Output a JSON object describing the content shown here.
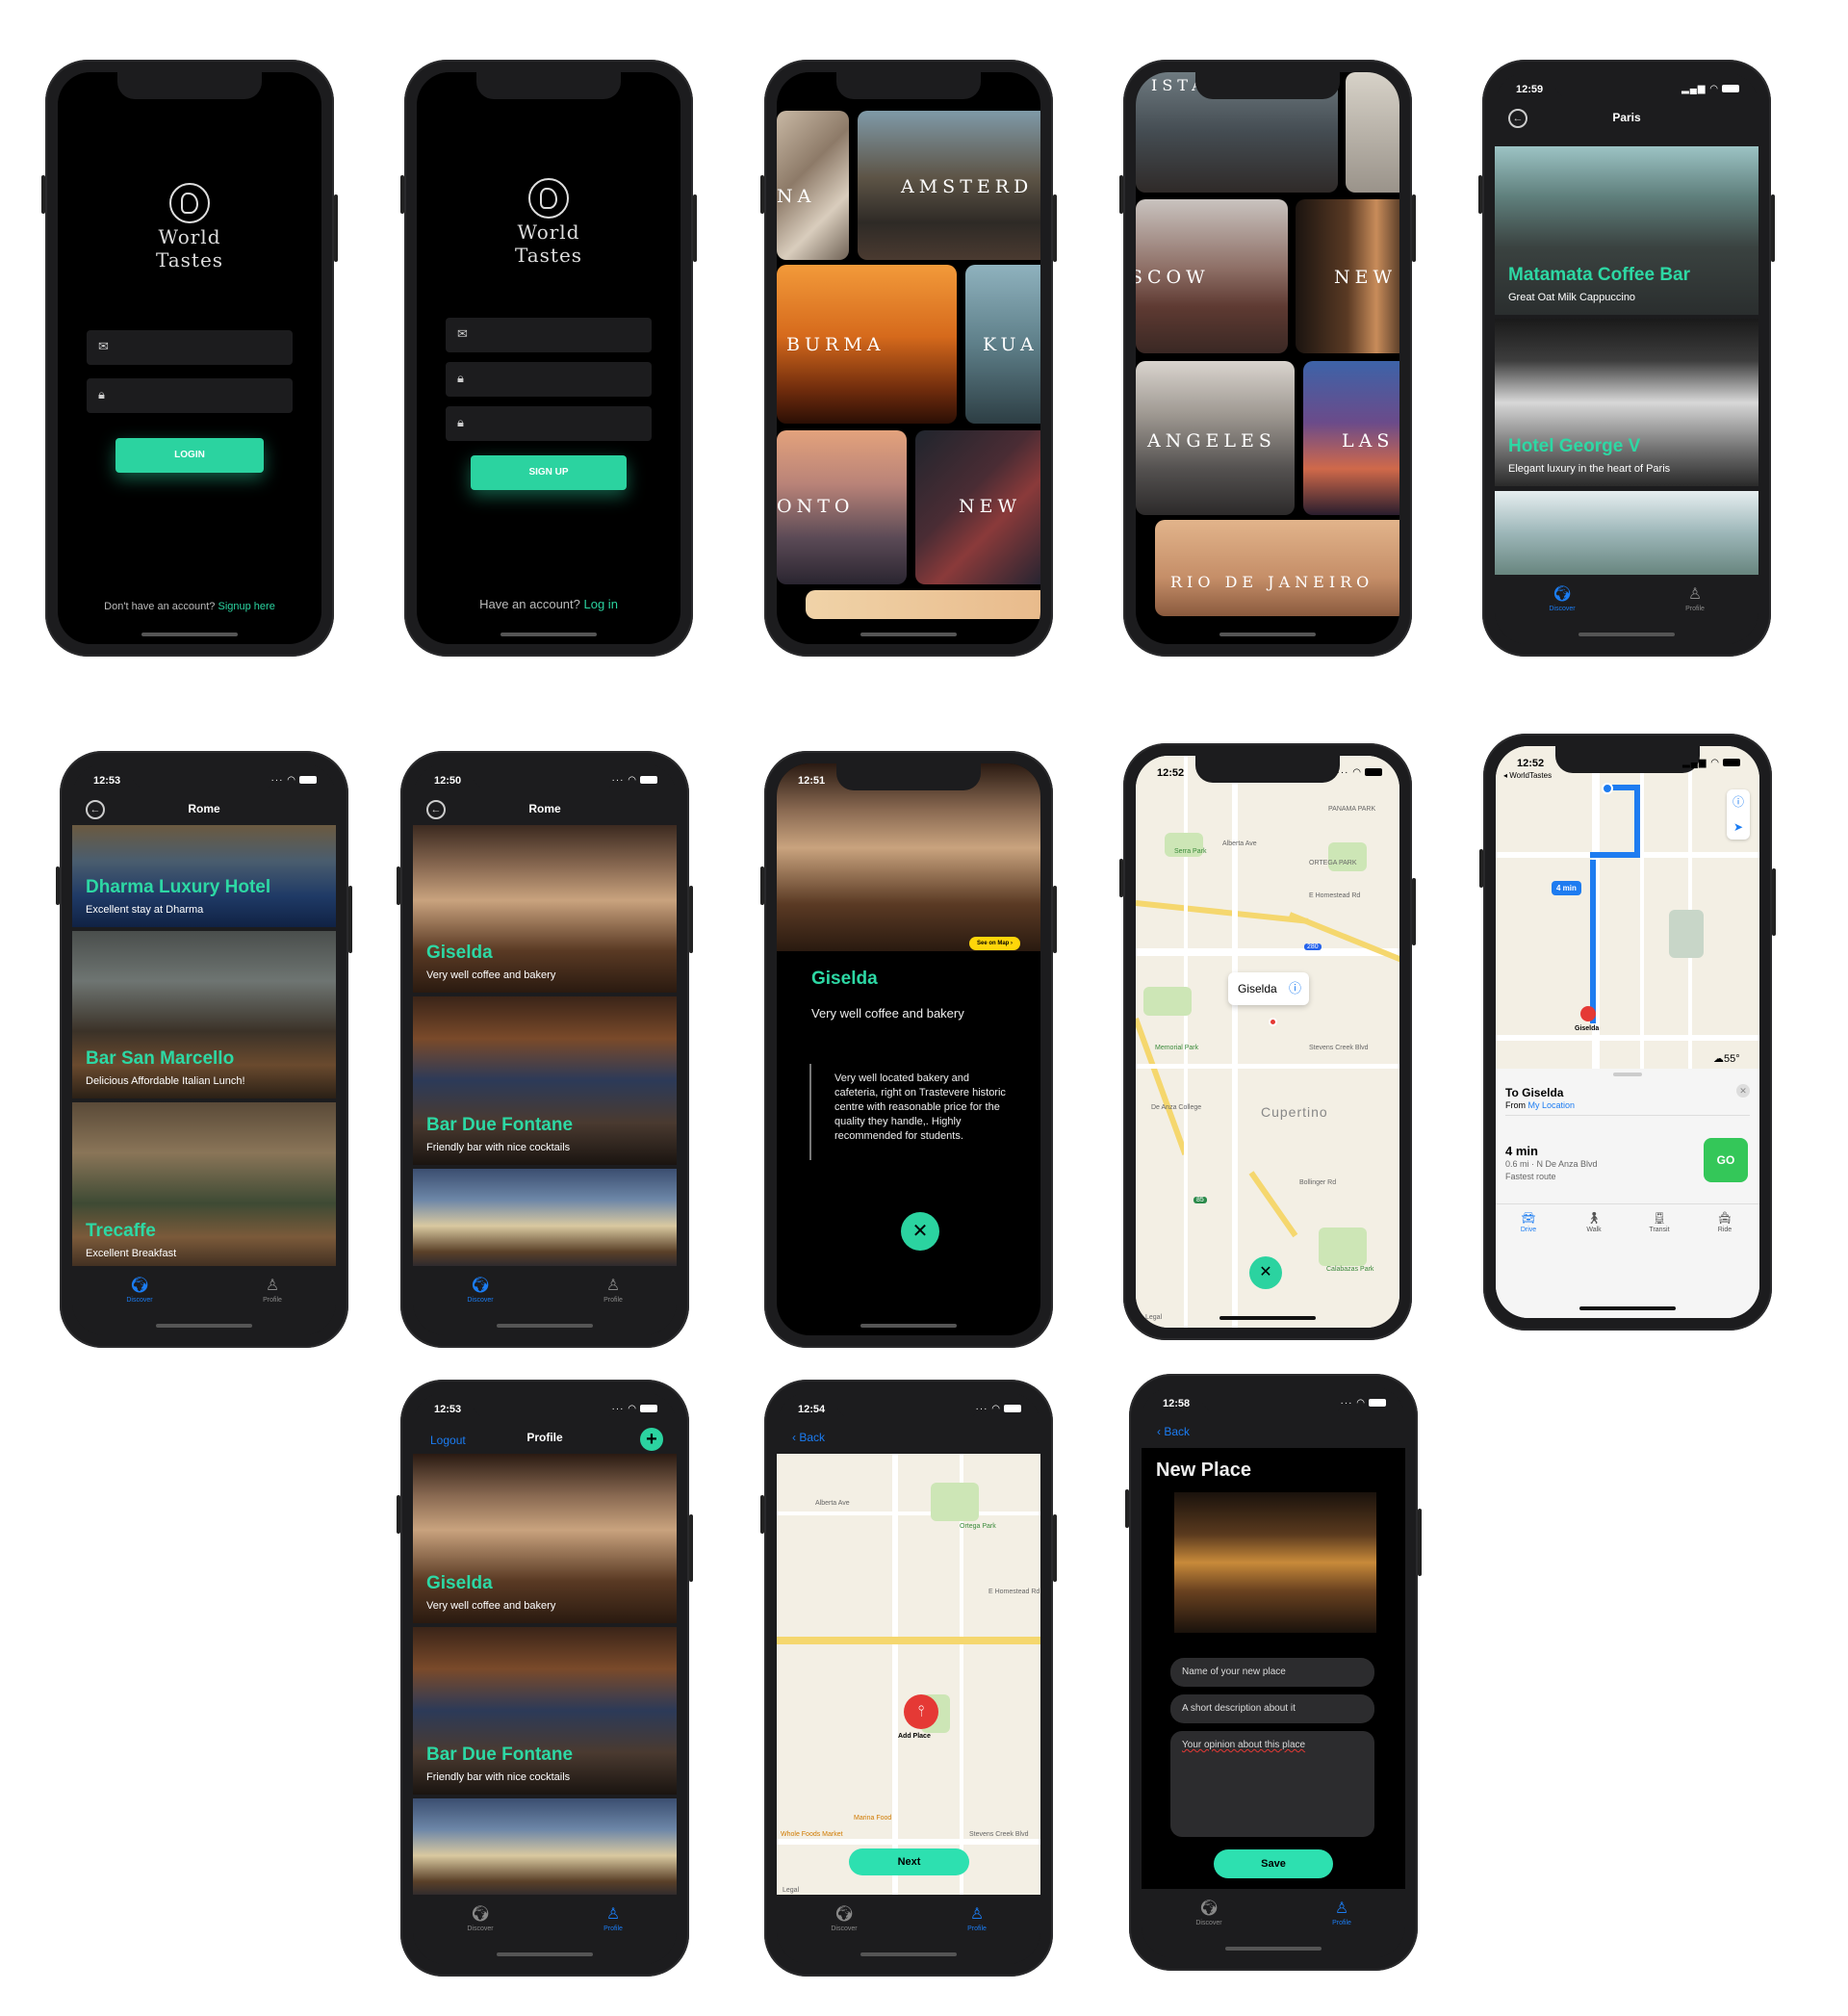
{
  "login": {
    "logo_line1": "World",
    "logo_line2": "Tastes",
    "button": "LOGIN",
    "footer_text": "Don't have an account?",
    "footer_link": "Signup here"
  },
  "signup": {
    "logo_line1": "World",
    "logo_line2": "Tastes",
    "button": "SIGN UP",
    "footer_text": "Have an account?",
    "footer_link": "Log in"
  },
  "cities_a": [
    "NA",
    "AMSTERD",
    "BURMA",
    "KUA",
    "ONTO",
    "NEW"
  ],
  "cities_b": [
    "ISTANBUL",
    "SCOW",
    "NEW",
    "ANGELES",
    "LAS",
    "RIO DE JANEIRO"
  ],
  "paris": {
    "time": "12:59",
    "title": "Paris",
    "cards": [
      {
        "title": "Matamata Coffee Bar",
        "subtitle": "Great Oat Milk Cappuccino"
      },
      {
        "title": "Hotel George V",
        "subtitle": "Elegant luxury in the heart of Paris"
      }
    ]
  },
  "rome1": {
    "time": "12:53",
    "title": "Rome",
    "cards": [
      {
        "title": "Dharma Luxury Hotel",
        "subtitle": "Excellent stay at Dharma"
      },
      {
        "title": "Bar San Marcello",
        "subtitle": "Delicious Affordable Italian Lunch!"
      },
      {
        "title": "Trecaffe",
        "subtitle": "Excellent Breakfast"
      }
    ]
  },
  "rome2": {
    "time": "12:50",
    "title": "Rome",
    "cards": [
      {
        "title": "Giselda",
        "subtitle": "Very well coffee and bakery"
      },
      {
        "title": "Bar Due Fontane",
        "subtitle": "Friendly bar with nice cocktails"
      }
    ]
  },
  "tabs": {
    "discover": "Discover",
    "profile": "Profile"
  },
  "detail": {
    "time": "12:51",
    "see_on_map": "See on Map",
    "title": "Giselda",
    "subtitle": "Very well coffee and bakery",
    "review": "Very well located bakery and cafeteria, right on Trastevere historic centre with  reasonable price for the quality they handle,. Highly recommended for students."
  },
  "map1": {
    "time": "12:52",
    "callout": "Giselda",
    "labels": [
      "PANAMA PARK",
      "Serra Park",
      "Alberta Ave",
      "ORTEGA PARK",
      "E Homestead Rd",
      "Memorial Park",
      "Stevens Creek Blvd",
      "De Anza College",
      "Cupertino",
      "Bollinger Rd",
      "Calabazas Park",
      "Legal"
    ],
    "hw_280": "280",
    "hw_85": "85"
  },
  "directions": {
    "time": "12:52",
    "back_app": "◂ WorldTastes",
    "eta_badge": "4 min",
    "pin_label": "Giselda",
    "temp": "55°",
    "to": "To Giselda",
    "from_prefix": "From",
    "from_link": "My Location",
    "duration": "4 min",
    "details": "0.6 mi · N De Anza Blvd",
    "fastest": "Fastest route",
    "go": "GO",
    "modes": [
      "Drive",
      "Walk",
      "Transit",
      "Ride"
    ]
  },
  "profile": {
    "time": "12:53",
    "logout": "Logout",
    "title": "Profile",
    "cards": [
      {
        "title": "Giselda",
        "subtitle": "Very well coffee and bakery"
      },
      {
        "title": "Bar Due Fontane",
        "subtitle": "Friendly bar with nice cocktails"
      }
    ]
  },
  "addmap": {
    "time": "12:54",
    "back": "Back",
    "labels": [
      "Alberta Ave",
      "Ortega Park",
      "E Homestead Rd",
      "Stevens Creek Blvd",
      "Whole Foods Market",
      "Marina Food",
      "Legal"
    ],
    "pin_label": "Add Place",
    "next": "Next"
  },
  "newplace": {
    "time": "12:58",
    "back": "Back",
    "title": "New Place",
    "name_placeholder": "Name of your new place",
    "desc_placeholder": "A short description about it",
    "opinion_placeholder": "Your opinion about this place",
    "save": "Save"
  },
  "colors": {
    "accent": "#2bd3a0",
    "link": "#1b7cf2",
    "go": "#34c759",
    "seemap": "#ffd60a"
  }
}
